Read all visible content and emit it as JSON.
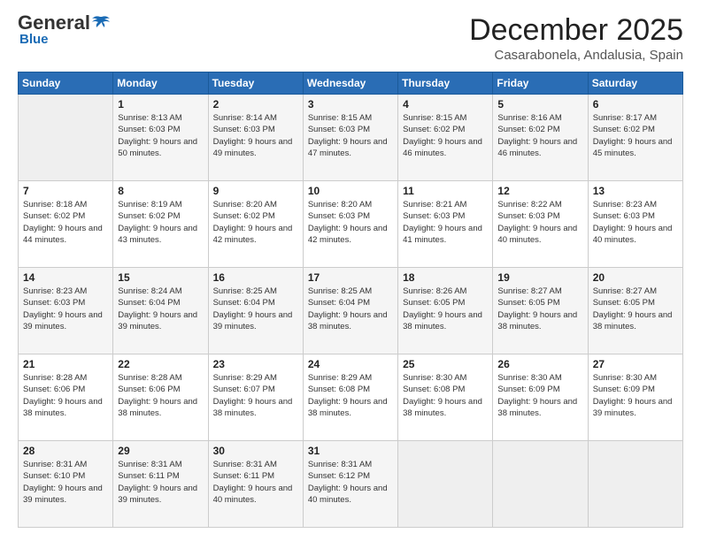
{
  "header": {
    "logo_general": "General",
    "logo_blue": "Blue",
    "title": "December 2025",
    "subtitle": "Casarabonela, Andalusia, Spain"
  },
  "calendar": {
    "days_of_week": [
      "Sunday",
      "Monday",
      "Tuesday",
      "Wednesday",
      "Thursday",
      "Friday",
      "Saturday"
    ],
    "weeks": [
      [
        {
          "day": "",
          "info": ""
        },
        {
          "day": "1",
          "info": "Sunrise: 8:13 AM\nSunset: 6:03 PM\nDaylight: 9 hours\nand 50 minutes."
        },
        {
          "day": "2",
          "info": "Sunrise: 8:14 AM\nSunset: 6:03 PM\nDaylight: 9 hours\nand 49 minutes."
        },
        {
          "day": "3",
          "info": "Sunrise: 8:15 AM\nSunset: 6:03 PM\nDaylight: 9 hours\nand 47 minutes."
        },
        {
          "day": "4",
          "info": "Sunrise: 8:15 AM\nSunset: 6:02 PM\nDaylight: 9 hours\nand 46 minutes."
        },
        {
          "day": "5",
          "info": "Sunrise: 8:16 AM\nSunset: 6:02 PM\nDaylight: 9 hours\nand 46 minutes."
        },
        {
          "day": "6",
          "info": "Sunrise: 8:17 AM\nSunset: 6:02 PM\nDaylight: 9 hours\nand 45 minutes."
        }
      ],
      [
        {
          "day": "7",
          "info": "Sunrise: 8:18 AM\nSunset: 6:02 PM\nDaylight: 9 hours\nand 44 minutes."
        },
        {
          "day": "8",
          "info": "Sunrise: 8:19 AM\nSunset: 6:02 PM\nDaylight: 9 hours\nand 43 minutes."
        },
        {
          "day": "9",
          "info": "Sunrise: 8:20 AM\nSunset: 6:02 PM\nDaylight: 9 hours\nand 42 minutes."
        },
        {
          "day": "10",
          "info": "Sunrise: 8:20 AM\nSunset: 6:03 PM\nDaylight: 9 hours\nand 42 minutes."
        },
        {
          "day": "11",
          "info": "Sunrise: 8:21 AM\nSunset: 6:03 PM\nDaylight: 9 hours\nand 41 minutes."
        },
        {
          "day": "12",
          "info": "Sunrise: 8:22 AM\nSunset: 6:03 PM\nDaylight: 9 hours\nand 40 minutes."
        },
        {
          "day": "13",
          "info": "Sunrise: 8:23 AM\nSunset: 6:03 PM\nDaylight: 9 hours\nand 40 minutes."
        }
      ],
      [
        {
          "day": "14",
          "info": "Sunrise: 8:23 AM\nSunset: 6:03 PM\nDaylight: 9 hours\nand 39 minutes."
        },
        {
          "day": "15",
          "info": "Sunrise: 8:24 AM\nSunset: 6:04 PM\nDaylight: 9 hours\nand 39 minutes."
        },
        {
          "day": "16",
          "info": "Sunrise: 8:25 AM\nSunset: 6:04 PM\nDaylight: 9 hours\nand 39 minutes."
        },
        {
          "day": "17",
          "info": "Sunrise: 8:25 AM\nSunset: 6:04 PM\nDaylight: 9 hours\nand 38 minutes."
        },
        {
          "day": "18",
          "info": "Sunrise: 8:26 AM\nSunset: 6:05 PM\nDaylight: 9 hours\nand 38 minutes."
        },
        {
          "day": "19",
          "info": "Sunrise: 8:27 AM\nSunset: 6:05 PM\nDaylight: 9 hours\nand 38 minutes."
        },
        {
          "day": "20",
          "info": "Sunrise: 8:27 AM\nSunset: 6:05 PM\nDaylight: 9 hours\nand 38 minutes."
        }
      ],
      [
        {
          "day": "21",
          "info": "Sunrise: 8:28 AM\nSunset: 6:06 PM\nDaylight: 9 hours\nand 38 minutes."
        },
        {
          "day": "22",
          "info": "Sunrise: 8:28 AM\nSunset: 6:06 PM\nDaylight: 9 hours\nand 38 minutes."
        },
        {
          "day": "23",
          "info": "Sunrise: 8:29 AM\nSunset: 6:07 PM\nDaylight: 9 hours\nand 38 minutes."
        },
        {
          "day": "24",
          "info": "Sunrise: 8:29 AM\nSunset: 6:08 PM\nDaylight: 9 hours\nand 38 minutes."
        },
        {
          "day": "25",
          "info": "Sunrise: 8:30 AM\nSunset: 6:08 PM\nDaylight: 9 hours\nand 38 minutes."
        },
        {
          "day": "26",
          "info": "Sunrise: 8:30 AM\nSunset: 6:09 PM\nDaylight: 9 hours\nand 38 minutes."
        },
        {
          "day": "27",
          "info": "Sunrise: 8:30 AM\nSunset: 6:09 PM\nDaylight: 9 hours\nand 39 minutes."
        }
      ],
      [
        {
          "day": "28",
          "info": "Sunrise: 8:31 AM\nSunset: 6:10 PM\nDaylight: 9 hours\nand 39 minutes."
        },
        {
          "day": "29",
          "info": "Sunrise: 8:31 AM\nSunset: 6:11 PM\nDaylight: 9 hours\nand 39 minutes."
        },
        {
          "day": "30",
          "info": "Sunrise: 8:31 AM\nSunset: 6:11 PM\nDaylight: 9 hours\nand 40 minutes."
        },
        {
          "day": "31",
          "info": "Sunrise: 8:31 AM\nSunset: 6:12 PM\nDaylight: 9 hours\nand 40 minutes."
        },
        {
          "day": "",
          "info": ""
        },
        {
          "day": "",
          "info": ""
        },
        {
          "day": "",
          "info": ""
        }
      ]
    ]
  }
}
